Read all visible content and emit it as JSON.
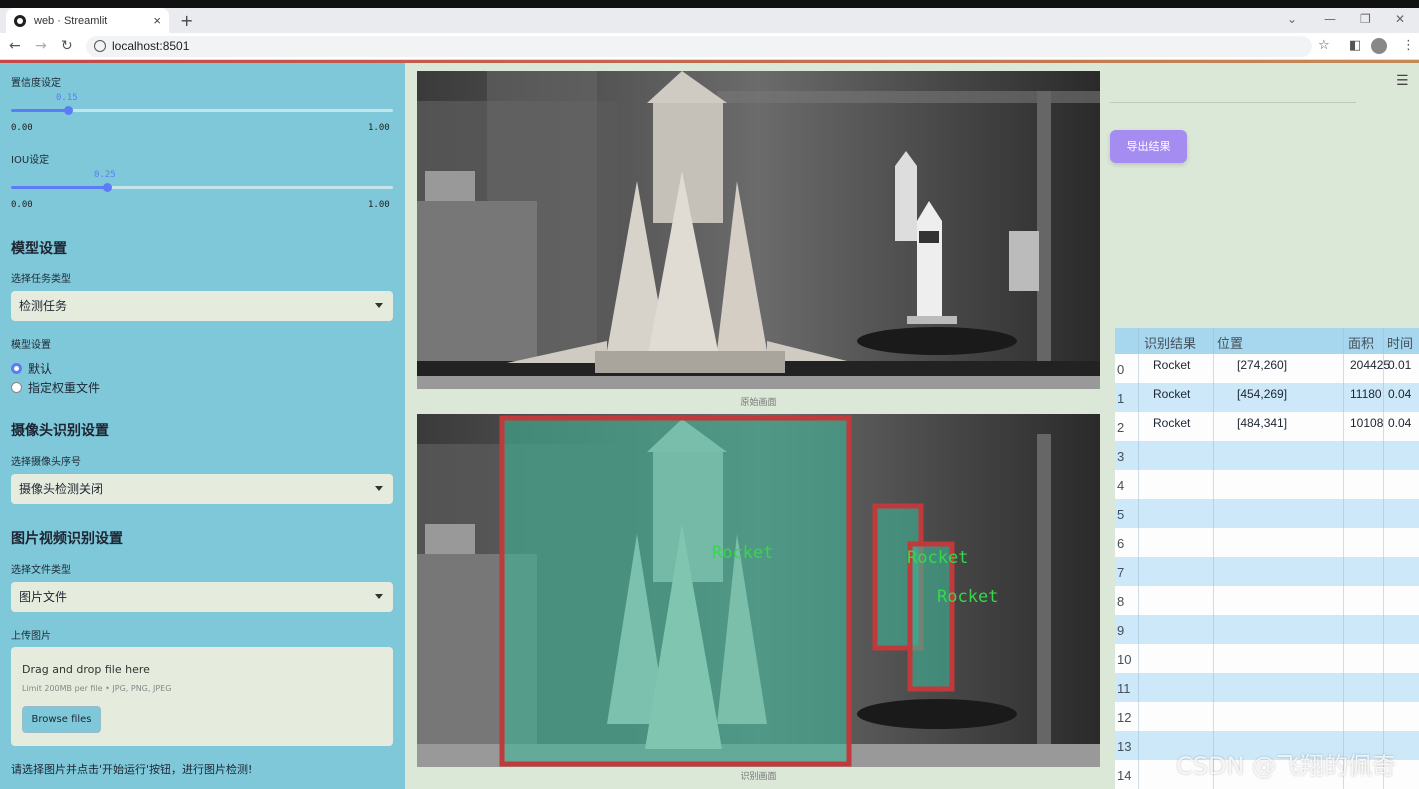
{
  "browser": {
    "tab_title": "web · Streamlit",
    "tab_close": "×",
    "new_tab": "+",
    "url": "localhost:8501",
    "win_min": "—",
    "win_restore": "❐",
    "win_close": "✕",
    "win_dropdown": "⌄"
  },
  "sidebar": {
    "confidence_label": "置信度设定",
    "confidence_value": "0.15",
    "confidence_fraction": 0.15,
    "confidence_min": "0.00",
    "confidence_max": "1.00",
    "iou_label": "IOU设定",
    "iou_value": "0.25",
    "iou_fraction": 0.25,
    "iou_min": "0.00",
    "iou_max": "1.00",
    "model_header": "模型设置",
    "task_type_label": "选择任务类型",
    "task_type_value": "检测任务",
    "model_settings_label": "模型设置",
    "radio_default": "默认",
    "radio_custom": "指定权重文件",
    "camera_header": "摄像头识别设置",
    "camera_select_label": "选择摄像头序号",
    "camera_select_value": "摄像头检测关闭",
    "media_header": "图片视频识别设置",
    "file_type_label": "选择文件类型",
    "file_type_value": "图片文件",
    "upload_label": "上传图片",
    "drag_drop": "Drag and drop file here",
    "upload_limit": "Limit 200MB per file • JPG, PNG, JPEG",
    "browse_button": "Browse files",
    "hint": "请选择图片并点击'开始运行'按钮，进行图片检测!"
  },
  "main": {
    "original_caption": "原始画面",
    "detected_caption": "识别画面",
    "export_button": "导出结果",
    "detection_label": "Rocket",
    "table": {
      "columns": [
        "识别结果",
        "位置",
        "面积",
        "时间"
      ],
      "rows": [
        {
          "idx": "0",
          "result": "Rocket",
          "position": "[274,260]",
          "area": "204425",
          "time": "0.01"
        },
        {
          "idx": "1",
          "result": "Rocket",
          "position": "[454,269]",
          "area": "11180",
          "time": "0.04"
        },
        {
          "idx": "2",
          "result": "Rocket",
          "position": "[484,341]",
          "area": "10108",
          "time": "0.04"
        },
        {
          "idx": "3"
        },
        {
          "idx": "4"
        },
        {
          "idx": "5"
        },
        {
          "idx": "6"
        },
        {
          "idx": "7"
        },
        {
          "idx": "8"
        },
        {
          "idx": "9"
        },
        {
          "idx": "10"
        },
        {
          "idx": "11"
        },
        {
          "idx": "12"
        },
        {
          "idx": "13"
        },
        {
          "idx": "14"
        }
      ]
    }
  },
  "watermark": "CSDN @飞翔的佩奇",
  "colors": {
    "sidebar_bg": "#7ec8d9",
    "main_bg": "#dbe8d8",
    "slider_accent": "#5c7cf7",
    "export_button": "#a58cf0",
    "box_red": "#c0393b",
    "label_green": "#36d84a"
  }
}
